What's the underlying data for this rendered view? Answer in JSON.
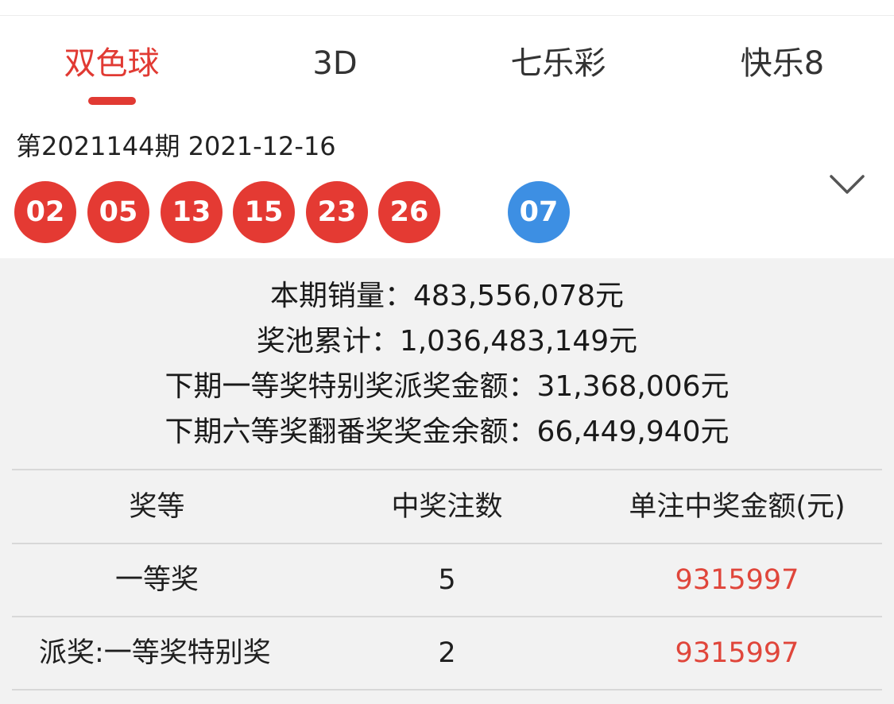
{
  "tabs": [
    {
      "label": "双色球",
      "active": true
    },
    {
      "label": "3D",
      "active": false
    },
    {
      "label": "七乐彩",
      "active": false
    },
    {
      "label": "快乐8",
      "active": false
    }
  ],
  "issue": {
    "text": "第2021144期 2021-12-16"
  },
  "balls": {
    "red": [
      "02",
      "05",
      "13",
      "15",
      "23",
      "26"
    ],
    "blue": [
      "07"
    ]
  },
  "summary": {
    "sales": "本期销量：483,556,078元",
    "pool": "奖池累计：1,036,483,149元",
    "special_first": "下期一等奖特别奖派奖金额：31,368,006元",
    "sixth_remaining": "下期六等奖翻番奖奖金余额：66,449,940元"
  },
  "table": {
    "headers": [
      "奖等",
      "中奖注数",
      "单注中奖金额(元)"
    ],
    "rows": [
      {
        "level": "一等奖",
        "count": "5",
        "amount": "9315997"
      },
      {
        "level": "派奖:一等奖特别奖",
        "count": "2",
        "amount": "9315997"
      }
    ]
  },
  "colors": {
    "accent": "#e13a33",
    "red_ball": "#e43a33",
    "blue_ball": "#3d8fe3",
    "amount": "#e0463b"
  },
  "icons": {
    "expand": "chevron-down-icon"
  }
}
